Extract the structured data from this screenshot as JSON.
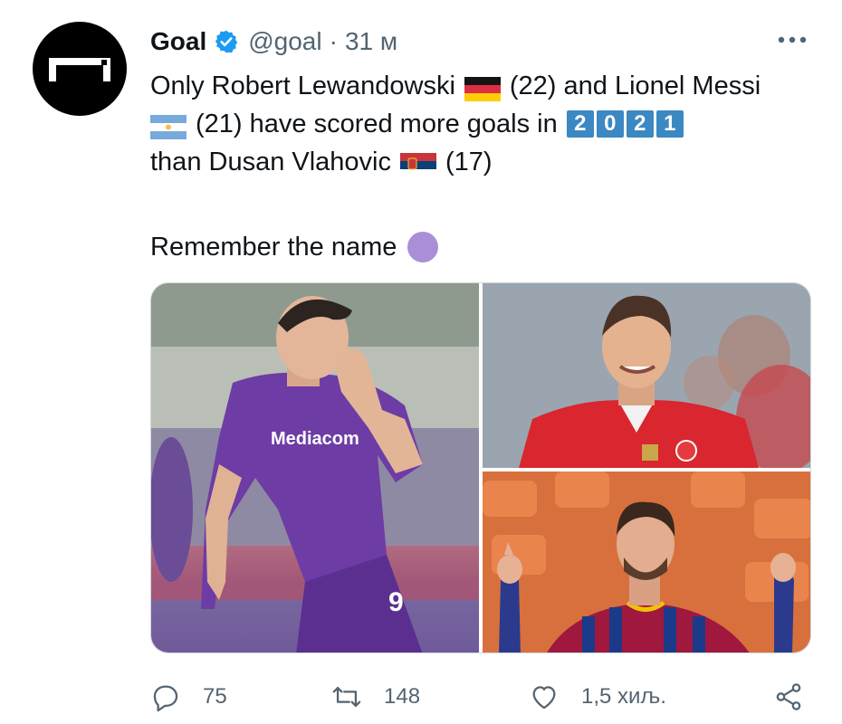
{
  "account": {
    "name": "Goal",
    "handle": "@goal",
    "separator": "·",
    "time": "31 м",
    "verified": true
  },
  "tweet": {
    "line1_a": "Only Robert Lewandowski",
    "line1_b": "(22) and Lionel Messi",
    "line2_a": "(21) have scored more goals in",
    "year_digits": [
      "2",
      "0",
      "2",
      "1"
    ],
    "line3_a": "than Dusan Vlahovic",
    "line3_b": "(17)",
    "line4": "Remember the name",
    "emojis": [
      "flag-germany",
      "flag-argentina",
      "keycap-digits",
      "flag-serbia",
      "purple-circle"
    ]
  },
  "media": {
    "photos": [
      {
        "name": "vlahovic-photo",
        "shirt_text": "Mediacom",
        "number": "9"
      },
      {
        "name": "lewandowski-photo"
      },
      {
        "name": "messi-photo"
      }
    ]
  },
  "actions": {
    "reply_count": "75",
    "retweet_count": "148",
    "like_count": "1,5 хиљ."
  },
  "colors": {
    "text": "#0f1419",
    "secondary": "#536471",
    "verified": "#1d9bf0",
    "keycap": "#3b88c3",
    "purple_circle": "#aa8ed6"
  }
}
